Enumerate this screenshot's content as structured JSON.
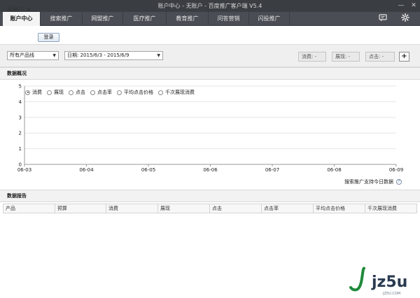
{
  "window": {
    "title": "账户中心 - 无账户 - 百度推广客户端 V5.4",
    "minimize": "—",
    "close": "✕"
  },
  "nav": {
    "tabs": [
      {
        "label": "账户中心",
        "active": true
      },
      {
        "label": "搜索推广",
        "active": false
      },
      {
        "label": "网盟推广",
        "active": false
      },
      {
        "label": "医疗推广",
        "active": false
      },
      {
        "label": "教育推广",
        "active": false
      },
      {
        "label": "问答营销",
        "active": false
      },
      {
        "label": "闪投推广",
        "active": false
      }
    ],
    "icons": [
      "chat-icon",
      "gear-icon"
    ]
  },
  "account": {
    "selected": "无账户",
    "login_label": "登录"
  },
  "filters": {
    "product": "所有产品线",
    "date": "日期: 2015/6/3 - 2015/6/9",
    "metric_buttons": [
      {
        "label": "消费: -"
      },
      {
        "label": "展现: -"
      },
      {
        "label": "点击: -"
      }
    ],
    "add_label": "+"
  },
  "overview": {
    "heading": "数据概况",
    "legend": [
      {
        "label": "消费",
        "selected": true
      },
      {
        "label": "展现",
        "selected": false
      },
      {
        "label": "点击",
        "selected": false
      },
      {
        "label": "点击率",
        "selected": false
      },
      {
        "label": "平均点击价格",
        "selected": false
      },
      {
        "label": "千次展现消费",
        "selected": false
      }
    ],
    "note": "搜索推广支持今日数据",
    "help": "?"
  },
  "chart_data": {
    "type": "line",
    "x": [
      "06-03",
      "06-04",
      "06-05",
      "06-06",
      "06-07",
      "06-08",
      "06-09"
    ],
    "yticks": [
      0,
      1,
      2,
      3,
      4,
      5
    ],
    "ylim": [
      0,
      5
    ],
    "series": [],
    "grid": true,
    "colors": {
      "axis": "#9a9a9a",
      "grid": "#e6e6e6"
    }
  },
  "report": {
    "heading": "数据报告",
    "columns": [
      "产品",
      "预算",
      "消费",
      "展现",
      "点击",
      "点击率",
      "平均点击价格",
      "千次展现消费"
    ],
    "rows": []
  },
  "watermark": {
    "logo": "jz5u",
    "url": "JZ5U.COM"
  },
  "colors": {
    "titlebar": "#3a3d42",
    "navbar": "#4a4e54",
    "active_tab": "#f4f4f4",
    "section": "#f2f2f2"
  }
}
